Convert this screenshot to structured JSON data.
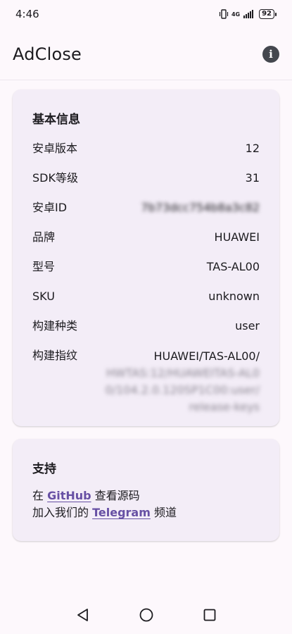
{
  "status_bar": {
    "time": "4:46",
    "network": "4G",
    "battery": "92"
  },
  "app_bar": {
    "title": "AdClose",
    "info_icon": "info-icon"
  },
  "basic_info": {
    "title": "基本信息",
    "rows": [
      {
        "label": "安卓版本",
        "value": "12"
      },
      {
        "label": "SDK等级",
        "value": "31"
      },
      {
        "label": "安卓ID",
        "value": "7b73dcc754b8a3c82"
      },
      {
        "label": "品牌",
        "value": "HUAWEI"
      },
      {
        "label": "型号",
        "value": "TAS-AL00"
      },
      {
        "label": "SKU",
        "value": "unknown"
      },
      {
        "label": "构建种类",
        "value": "user"
      }
    ],
    "fingerprint": {
      "label": "构建指纹",
      "line1": "HUAWEI/TAS-AL00/",
      "line2": "HWTAS:12/HUAWEITAS-AL0",
      "line3": "0/104.2.0.120SP1C00:user/",
      "line4": "release-keys"
    }
  },
  "support": {
    "title": "支持",
    "line1_prefix": "在 ",
    "github_link": "GitHub",
    "line1_suffix": " 查看源码",
    "line2_prefix": "加入我们的 ",
    "telegram_link": "Telegram",
    "line2_suffix": " 频道"
  },
  "nav_bar": {
    "back_icon": "back-icon",
    "home_icon": "home-icon",
    "recents_icon": "recents-icon"
  }
}
